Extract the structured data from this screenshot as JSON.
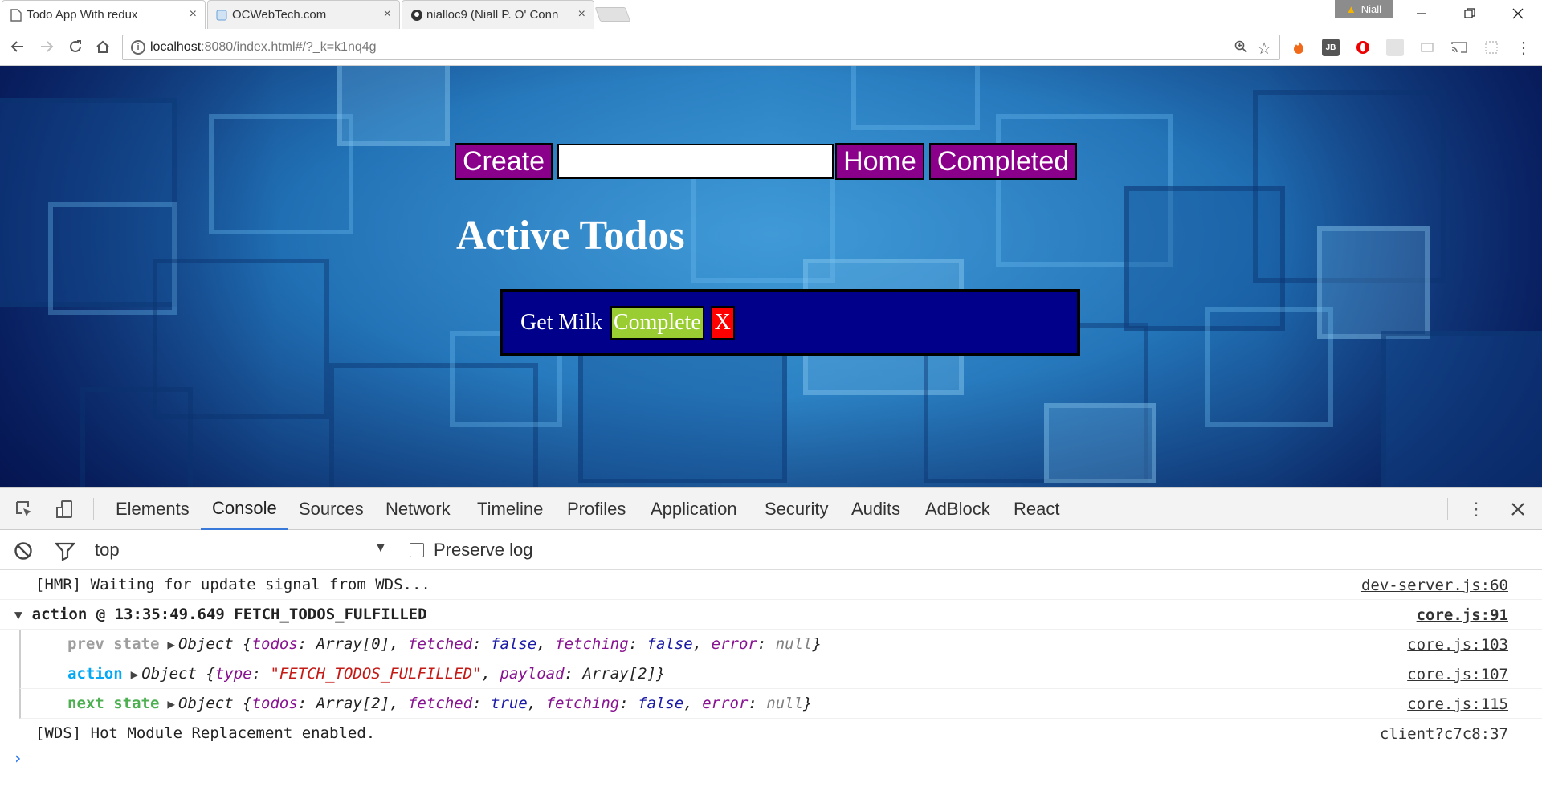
{
  "browser": {
    "tabs": [
      {
        "title": "Todo App With redux",
        "active": true,
        "icon": "document-icon"
      },
      {
        "title": "OCWebTech.com",
        "active": false,
        "icon": "globe-icon"
      },
      {
        "title": "nialloc9 (Niall P. O' Conn",
        "active": false,
        "icon": "github-icon"
      }
    ],
    "close_glyph": "×",
    "profile_name": "Niall",
    "url_host": "localhost",
    "url_rest": ":8080/index.html#/?_k=k1nq4g"
  },
  "app": {
    "create_label": "Create",
    "input_value": "",
    "home_label": "Home",
    "completed_label": "Completed",
    "heading": "Active Todos",
    "todos": [
      {
        "text": "Get Milk",
        "complete_label": "Complete",
        "delete_label": "X"
      }
    ]
  },
  "devtools": {
    "tabs": [
      "Elements",
      "Console",
      "Sources",
      "Network",
      "Timeline",
      "Profiles",
      "Application",
      "Security",
      "Audits",
      "AdBlock",
      "React"
    ],
    "active_tab": "Console",
    "context": "top",
    "preserve_log_label": "Preserve log",
    "preserve_log_checked": false,
    "console": {
      "hmr_msg": "[HMR] Waiting for update signal from WDS...",
      "hmr_src": "dev-server.js:60",
      "group_title": "action @ 13:35:49.649 FETCH_TODOS_FULFILLED",
      "group_src": "core.js:91",
      "prev_label": "prev state",
      "prev_src": "core.js:103",
      "action_label": "action",
      "action_src": "core.js:107",
      "next_label": "next state",
      "next_src": "core.js:115",
      "wds_msg": "[WDS] Hot Module Replacement enabled.",
      "wds_src": "client?c7c8:37",
      "obj_word": "Object",
      "prev_obj": {
        "todos": "Array[0]",
        "fetched": "false",
        "fetching": "false",
        "error": "null"
      },
      "action_obj": {
        "type": "\"FETCH_TODOS_FULFILLED\"",
        "payload": "Array[2]"
      },
      "next_obj": {
        "todos": "Array[2]",
        "fetched": "true",
        "fetching": "false",
        "error": "null"
      }
    }
  }
}
